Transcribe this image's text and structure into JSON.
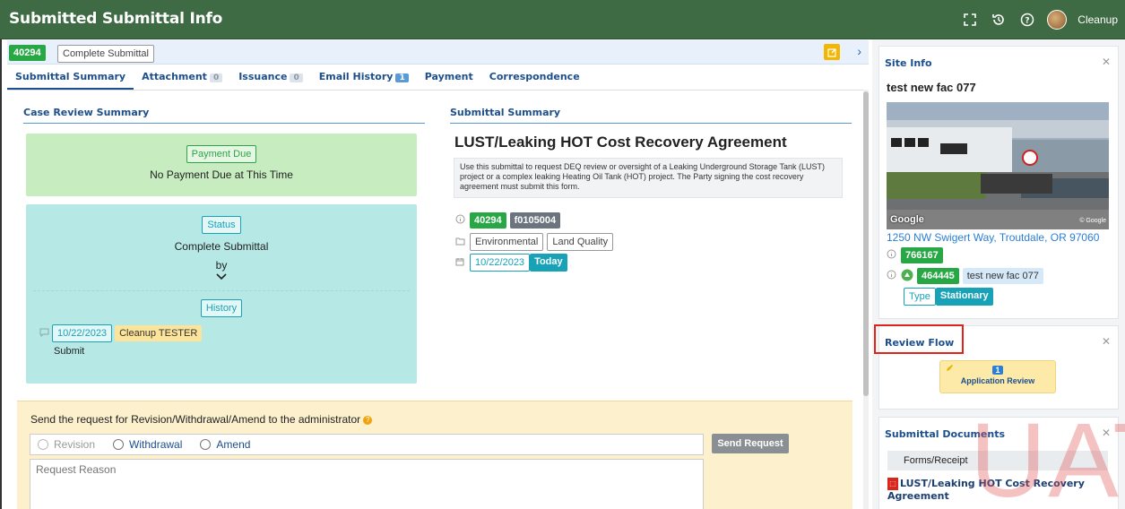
{
  "header": {
    "title": "Submitted Submittal Info",
    "user_name": "Cleanup",
    "icons": [
      "fullscreen-icon",
      "history-icon",
      "help-icon",
      "avatar"
    ]
  },
  "subheader": {
    "submittal_id": "40294",
    "status": "Complete Submittal"
  },
  "tabs": [
    {
      "label": "Submittal Summary",
      "count": null
    },
    {
      "label": "Attachment",
      "count": "0"
    },
    {
      "label": "Issuance",
      "count": "0"
    },
    {
      "label": "Email History",
      "count": "1"
    },
    {
      "label": "Payment",
      "count": null
    },
    {
      "label": "Correspondence",
      "count": null
    }
  ],
  "case_review": {
    "title": "Case Review Summary",
    "payment_badge": "Payment Due",
    "payment_text": "No Payment Due at This Time",
    "status_badge": "Status",
    "status_text": "Complete Submittal",
    "by_text": "by",
    "history_badge": "History",
    "history_date": "10/22/2023",
    "history_user": "Cleanup TESTER",
    "history_action": "Submit"
  },
  "submittal_summary": {
    "title": "Submittal Summary",
    "heading": "LUST/Leaking HOT Cost Recovery Agreement",
    "description": "Use this submittal to request DEQ review or oversight of a Leaking Underground Storage Tank (LUST) project or a complex leaking Heating Oil Tank (HOT) project. The Party signing the cost recovery agreement must submit this form.",
    "id": "40294",
    "form_code": "f0105004",
    "category": "Environmental",
    "program": "Land Quality",
    "date": "10/22/2023",
    "date_label": "Today"
  },
  "revision": {
    "title": "Send the request for Revision/Withdrawal/Amend to the administrator",
    "options": [
      "Revision",
      "Withdrawal",
      "Amend"
    ],
    "send_label": "Send Request",
    "reason_placeholder": "Request Reason"
  },
  "site_info": {
    "title": "Site Info",
    "name": "test new fac 077",
    "address": "1250 NW Swigert Way, Troutdale, OR 97060",
    "photo_brand": "Google",
    "photo_credit": "© Google",
    "site_id": "766167",
    "facility_id": "464445",
    "facility_name": "test new fac 077",
    "type_label": "Type",
    "type_value": "Stationary"
  },
  "review_flow": {
    "title": "Review Flow",
    "step_number": "1",
    "step_label": "Application Review"
  },
  "submittal_documents": {
    "title": "Submittal Documents",
    "group": "Forms/Receipt",
    "document": "LUST/Leaking HOT Cost Recovery Agreement"
  },
  "watermark": "UAT",
  "colors": {
    "header_green": "#3e6b44",
    "accent_blue": "#1c4f8c",
    "badge_green": "#28a745",
    "badge_teal": "#17a2b8",
    "highlight_red": "#e2231a"
  }
}
